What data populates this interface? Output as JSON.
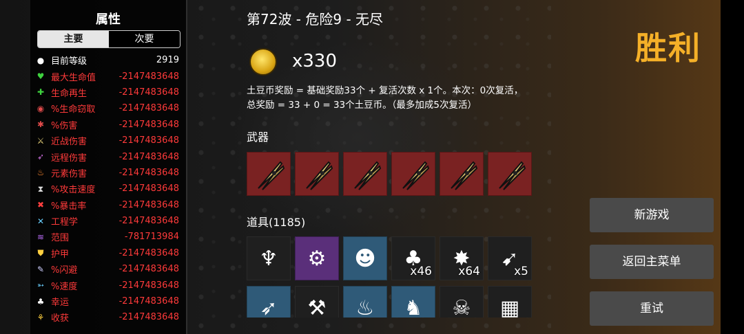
{
  "stats": {
    "title": "属性",
    "tabs": [
      {
        "label": "主要"
      },
      {
        "label": "次要"
      }
    ],
    "rows": [
      {
        "name": "目前等级",
        "value": "2919",
        "color": "white",
        "icon": "level-icon"
      },
      {
        "name": "最大生命值",
        "value": "-2147483648",
        "color": "red",
        "icon": "heart-icon"
      },
      {
        "name": "生命再生",
        "value": "-2147483648",
        "color": "red",
        "icon": "regen-icon"
      },
      {
        "name": "%生命窃取",
        "value": "-2147483648",
        "color": "red",
        "icon": "lifesteal-icon"
      },
      {
        "name": "%伤害",
        "value": "-2147483648",
        "color": "red",
        "icon": "damage-icon"
      },
      {
        "name": "近战伤害",
        "value": "-2147483648",
        "color": "red",
        "icon": "melee-icon"
      },
      {
        "name": "远程伤害",
        "value": "-2147483648",
        "color": "red",
        "icon": "ranged-icon"
      },
      {
        "name": "元素伤害",
        "value": "-2147483648",
        "color": "red",
        "icon": "elemental-icon"
      },
      {
        "name": "%攻击速度",
        "value": "-2147483648",
        "color": "red",
        "icon": "attack-speed-icon"
      },
      {
        "name": "%暴击率",
        "value": "-2147483648",
        "color": "red",
        "icon": "crit-icon"
      },
      {
        "name": "工程学",
        "value": "-2147483648",
        "color": "red",
        "icon": "engineering-icon"
      },
      {
        "name": "范围",
        "value": "-781713984",
        "color": "red",
        "icon": "range-icon"
      },
      {
        "name": "护甲",
        "value": "-2147483648",
        "color": "red",
        "icon": "armor-icon"
      },
      {
        "name": "%闪避",
        "value": "-2147483648",
        "color": "red",
        "icon": "dodge-icon"
      },
      {
        "name": "%速度",
        "value": "-2147483648",
        "color": "red",
        "icon": "speed-icon"
      },
      {
        "name": "幸运",
        "value": "-2147483648",
        "color": "red",
        "icon": "luck-icon"
      },
      {
        "name": "收获",
        "value": "-2147483648",
        "color": "red",
        "icon": "harvest-icon"
      }
    ]
  },
  "main": {
    "wave_title": "第72波 - 危险9 - 无尽",
    "coin_count": "x330",
    "desc_line1": "土豆币奖励 = 基础奖励33个 + 复活次数 x 1个。本次：0次复活，",
    "desc_line2": "总奖励 = 33 + 0 = 33个土豆币。（最多加成5次复活）",
    "weapons_label": "武器",
    "items_label": "道具(1185)",
    "weapons": [
      "pruner-icon",
      "pruner-icon",
      "pruner-icon",
      "pruner-icon",
      "pruner-icon",
      "pruner-icon"
    ],
    "items_row1": [
      {
        "icon": "demon-icon",
        "style": "dark",
        "count": "",
        "glyph": "♆"
      },
      {
        "icon": "sawblade-icon",
        "style": "purple",
        "count": "",
        "glyph": "⚙"
      },
      {
        "icon": "clown-mask-icon",
        "style": "blue",
        "count": "",
        "glyph": "☻"
      },
      {
        "icon": "tree-icon",
        "style": "dark",
        "count": "x46",
        "glyph": "♣"
      },
      {
        "icon": "dynamite-icon",
        "style": "dark",
        "count": "x64",
        "glyph": "✸"
      },
      {
        "icon": "ferret-icon",
        "style": "dark",
        "count": "x5",
        "glyph": "➹"
      }
    ],
    "items_row2": [
      {
        "icon": "feather-icon",
        "style": "blue",
        "count": "",
        "glyph": "➶"
      },
      {
        "icon": "pickaxe-icon",
        "style": "dark",
        "count": "",
        "glyph": "⚒"
      },
      {
        "icon": "pig-icon",
        "style": "blue",
        "count": "",
        "glyph": "♨"
      },
      {
        "icon": "rabbit-icon",
        "style": "blue",
        "count": "",
        "glyph": "♞"
      },
      {
        "icon": "skull-icon",
        "style": "dark",
        "count": "",
        "glyph": "☠"
      },
      {
        "icon": "shirt-icon",
        "style": "dark",
        "count": "",
        "glyph": "▦"
      }
    ]
  },
  "right": {
    "victory": "胜利",
    "buttons": [
      {
        "label": "新游戏"
      },
      {
        "label": "返回主菜单"
      },
      {
        "label": "重试"
      }
    ]
  },
  "colors": {
    "accent": "#f5b028",
    "stat_red": "#ff3a3a",
    "weapon_bg": "#7a2222",
    "item_purple": "#5a2f7a",
    "item_blue": "#2f5a78",
    "button": "#4a4a4a"
  }
}
